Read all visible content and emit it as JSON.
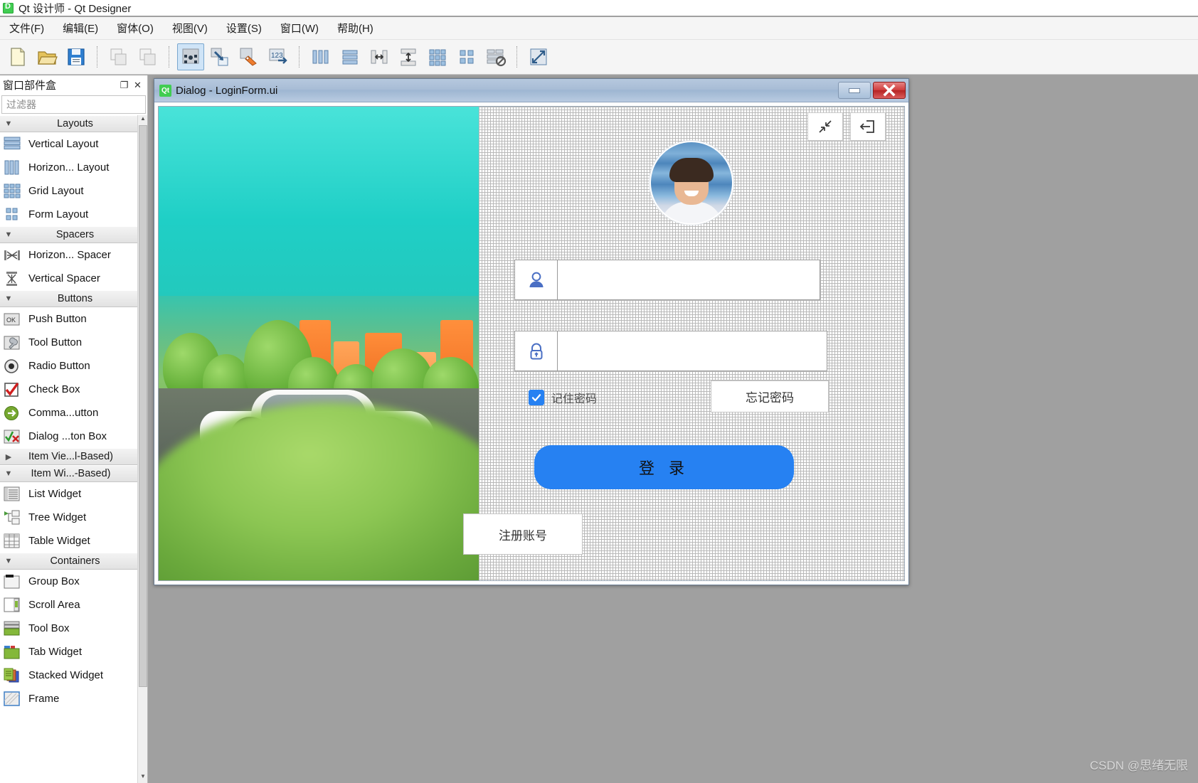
{
  "app": {
    "title": "Qt 设计师 - Qt Designer",
    "logo_text": "D"
  },
  "menu": {
    "items": [
      {
        "label": "文件(F)",
        "name": "menu-file"
      },
      {
        "label": "编辑(E)",
        "name": "menu-edit"
      },
      {
        "label": "窗体(O)",
        "name": "menu-form"
      },
      {
        "label": "视图(V)",
        "name": "menu-view"
      },
      {
        "label": "设置(S)",
        "name": "menu-settings"
      },
      {
        "label": "窗口(W)",
        "name": "menu-window"
      },
      {
        "label": "帮助(H)",
        "name": "menu-help"
      }
    ]
  },
  "toolbar": {
    "groups": [
      [
        "new-file-icon",
        "open-file-icon",
        "save-file-icon"
      ],
      [
        "undo-icon",
        "redo-icon"
      ],
      [
        "edit-widgets-icon",
        "edit-signals-slots-icon",
        "edit-buddies-icon",
        "edit-tab-order-icon"
      ],
      [
        "layout-horizontally-icon",
        "layout-vertically-icon",
        "layout-splitter-horizontal-icon",
        "layout-splitter-vertical-icon",
        "layout-grid-icon",
        "layout-form-icon",
        "break-layout-icon"
      ],
      [
        "adjust-size-icon"
      ]
    ],
    "active_index": "edit-widgets-icon"
  },
  "widget_box": {
    "title": "窗口部件盒",
    "float_label": "❐",
    "close_label": "✕",
    "filter_placeholder": "过滤器",
    "filter_value": "",
    "groups": [
      {
        "name": "Layouts",
        "expanded": true,
        "items": [
          {
            "label": "Vertical Layout",
            "icon": "vertical-layout-icon"
          },
          {
            "label": "Horizon... Layout",
            "icon": "horizontal-layout-icon"
          },
          {
            "label": "Grid Layout",
            "icon": "grid-layout-icon"
          },
          {
            "label": "Form Layout",
            "icon": "form-layout-icon"
          }
        ]
      },
      {
        "name": "Spacers",
        "expanded": true,
        "items": [
          {
            "label": "Horizon... Spacer",
            "icon": "horizontal-spacer-icon"
          },
          {
            "label": "Vertical Spacer",
            "icon": "vertical-spacer-icon"
          }
        ]
      },
      {
        "name": "Buttons",
        "expanded": true,
        "items": [
          {
            "label": "Push Button",
            "icon": "push-button-icon"
          },
          {
            "label": "Tool Button",
            "icon": "tool-button-icon"
          },
          {
            "label": "Radio Button",
            "icon": "radio-button-icon"
          },
          {
            "label": "Check Box",
            "icon": "check-box-icon"
          },
          {
            "label": "Comma...utton",
            "icon": "command-link-button-icon"
          },
          {
            "label": "Dialog ...ton Box",
            "icon": "dialog-button-box-icon"
          }
        ]
      },
      {
        "name": "Item Vie...l-Based)",
        "expanded": false,
        "items": []
      },
      {
        "name": "Item Wi...-Based)",
        "expanded": true,
        "items": [
          {
            "label": "List Widget",
            "icon": "list-widget-icon"
          },
          {
            "label": "Tree Widget",
            "icon": "tree-widget-icon"
          },
          {
            "label": "Table Widget",
            "icon": "table-widget-icon"
          }
        ]
      },
      {
        "name": "Containers",
        "expanded": true,
        "items": [
          {
            "label": "Group Box",
            "icon": "group-box-icon"
          },
          {
            "label": "Scroll Area",
            "icon": "scroll-area-icon"
          },
          {
            "label": "Tool Box",
            "icon": "tool-box-icon"
          },
          {
            "label": "Tab Widget",
            "icon": "tab-widget-icon"
          },
          {
            "label": "Stacked Widget",
            "icon": "stacked-widget-icon"
          },
          {
            "label": "Frame",
            "icon": "frame-icon"
          }
        ]
      }
    ]
  },
  "dialog": {
    "icon_text": "Qt",
    "title": "Dialog - LoginForm.ui",
    "minimize_label": "minimize-button",
    "close_label": "close-button"
  },
  "login_form": {
    "corner_buttons": [
      {
        "name": "collapse-button",
        "icon": "collapse-arrows-icon"
      },
      {
        "name": "exit-button",
        "icon": "exit-door-icon"
      }
    ],
    "avatar_name": "user-avatar",
    "username": {
      "value": "",
      "placeholder": "",
      "icon": "user-icon"
    },
    "password": {
      "value": "",
      "placeholder": "",
      "icon": "lock-icon"
    },
    "remember": {
      "label": "记住密码",
      "checked": true
    },
    "forgot_label": "忘记密码",
    "login_label": "登 录",
    "register_label": "注册账号",
    "accent_color": "#2681f2",
    "icon_color": "#4a6fc4"
  },
  "watermark": {
    "text": "CSDN @思绪无限"
  }
}
